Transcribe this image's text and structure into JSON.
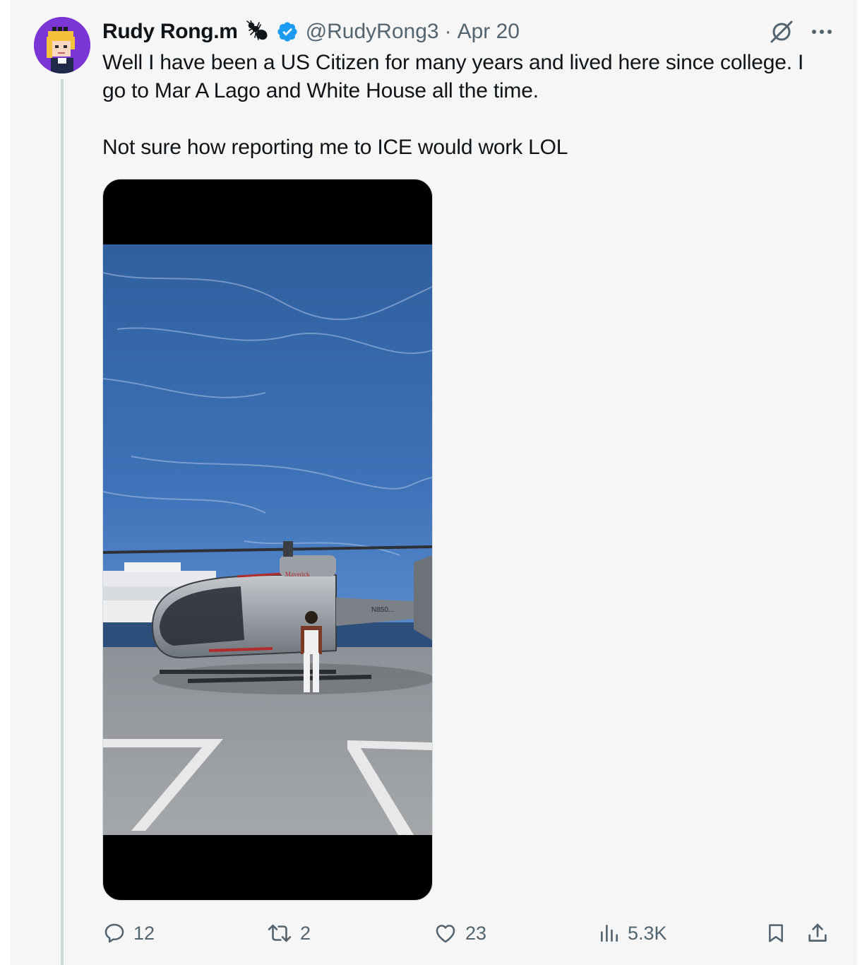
{
  "tweet": {
    "author": {
      "display_name": "Rudy Rong.m",
      "handle": "@RudyRong3",
      "badge_icon": "ant-icon",
      "verified_icon": "verified-badge-icon",
      "avatar_color": "#7b35d6"
    },
    "separator": "·",
    "date": "Apr 20",
    "text_line_1": "Well I have been a US Citizen for many years and lived here since college. I",
    "text_line_2": "go to Mar A Lago and White House all the time.",
    "text_line_3": "Not sure how reporting me to ICE would work LOL",
    "media": {
      "type": "video",
      "helicopter_text": "Maverick",
      "tail_number": "N850..."
    },
    "stats": {
      "replies": "12",
      "reposts": "2",
      "likes": "23",
      "views": "5.3K"
    }
  },
  "colors": {
    "accent": "#1d9bf0",
    "secondary_text": "#536471",
    "background": "#f6f6f6"
  }
}
